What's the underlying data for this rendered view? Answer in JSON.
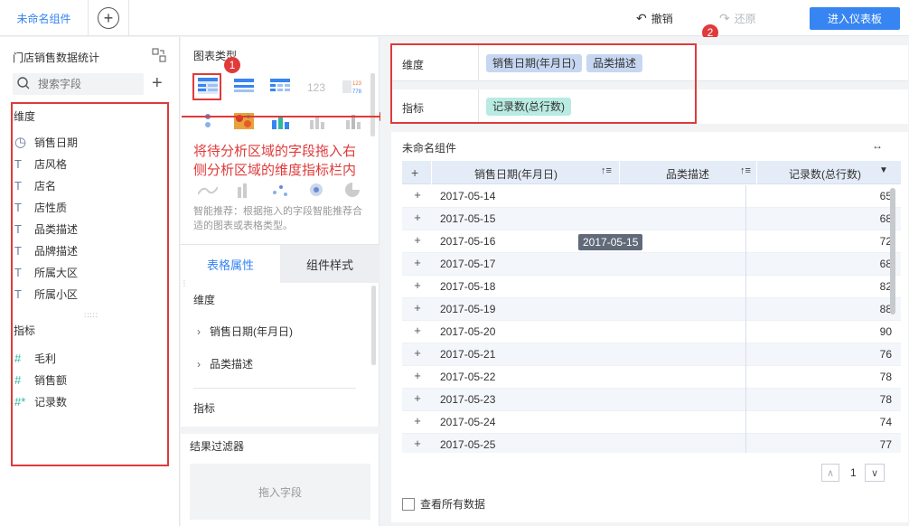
{
  "topbar": {
    "tab_label": "未命名组件",
    "add_tab": "+",
    "undo_label": "撤销",
    "redo_label": "还原",
    "enter_dashboard": "进入仪表板"
  },
  "left_panel": {
    "dataset_name": "门店销售数据统计",
    "search_placeholder": "搜索字段",
    "dimension_title": "维度",
    "dimensions": [
      {
        "icon": "clock-icon",
        "label": "销售日期"
      },
      {
        "icon": "text-icon",
        "label": "店风格"
      },
      {
        "icon": "text-icon",
        "label": "店名"
      },
      {
        "icon": "text-icon",
        "label": "店性质"
      },
      {
        "icon": "text-icon",
        "label": "品类描述"
      },
      {
        "icon": "text-icon",
        "label": "品牌描述"
      },
      {
        "icon": "text-icon",
        "label": "所属大区"
      },
      {
        "icon": "text-icon",
        "label": "所属小区"
      }
    ],
    "metric_title": "指标",
    "metrics": [
      {
        "icon": "hash-icon",
        "label": "毛利"
      },
      {
        "icon": "hash-icon",
        "label": "销售额"
      },
      {
        "icon": "hash-star-icon",
        "label": "记录数"
      }
    ]
  },
  "mid_panel": {
    "chart_type_title": "图表类型",
    "annotation_text_1": "将待分析区域的字段拖入右",
    "annotation_text_2": "侧分析区域的维度指标栏内",
    "smart_hint": "智能推荐：根据拖入的字段智能推荐合适的图表或表格类型。",
    "tabs": [
      "表格属性",
      "组件样式"
    ],
    "dimension_label": "维度",
    "dim_items": [
      "销售日期(年月日)",
      "品类描述"
    ],
    "metric_label": "指标",
    "filter_title": "结果过滤器",
    "drop_hint": "拖入字段"
  },
  "badges": {
    "one": "1",
    "two": "2"
  },
  "analysis": {
    "dimension_label": "维度",
    "dimension_chips": [
      "销售日期(年月日)",
      "品类描述"
    ],
    "metric_label": "指标",
    "metric_chips": [
      "记录数(总行数)"
    ]
  },
  "table": {
    "title": "未命名组件",
    "headers": [
      "+",
      "销售日期(年月日)",
      "品类描述",
      "记录数(总行数)"
    ],
    "rows": [
      {
        "date": "2017-05-14",
        "value": "65"
      },
      {
        "date": "2017-05-15",
        "value": "68"
      },
      {
        "date": "2017-05-16",
        "value": "72"
      },
      {
        "date": "2017-05-17",
        "value": "68"
      },
      {
        "date": "2017-05-18",
        "value": "82"
      },
      {
        "date": "2017-05-19",
        "value": "88"
      },
      {
        "date": "2017-05-20",
        "value": "90"
      },
      {
        "date": "2017-05-21",
        "value": "76"
      },
      {
        "date": "2017-05-22",
        "value": "78"
      },
      {
        "date": "2017-05-23",
        "value": "78"
      },
      {
        "date": "2017-05-24",
        "value": "74"
      },
      {
        "date": "2017-05-25",
        "value": "77"
      }
    ],
    "tooltip": "2017-05-15",
    "page": "1",
    "view_all": "查看所有数据"
  },
  "colors": {
    "accent": "#3685f2",
    "annotation_red": "#e03a3a",
    "dim_chip": "#c7d7f2",
    "metric_chip": "#b8ebe2"
  }
}
